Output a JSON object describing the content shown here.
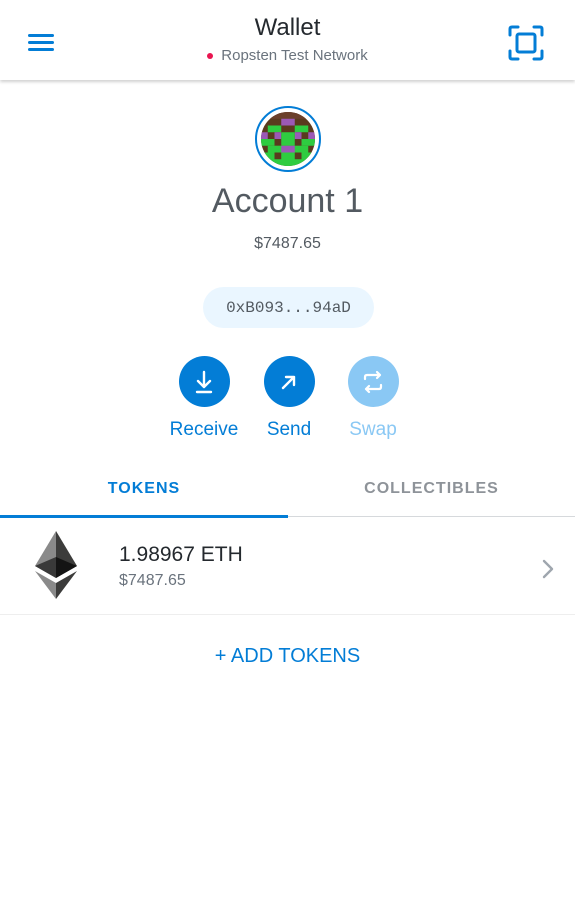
{
  "header": {
    "title": "Wallet",
    "network_name": "Ropsten Test Network",
    "network_color": "#e91550",
    "menu_icon": "hamburger-menu-icon",
    "scan_icon": "qr-scan-icon"
  },
  "account": {
    "name": "Account 1",
    "balance": "$7487.65",
    "address_short": "0xB093...94aD",
    "avatar_icon": "identicon-avatar"
  },
  "actions": {
    "receive": {
      "label": "Receive",
      "icon": "receive-arrow-down-icon"
    },
    "send": {
      "label": "Send",
      "icon": "send-arrow-up-right-icon"
    },
    "swap": {
      "label": "Swap",
      "icon": "swap-arrows-icon",
      "disabled": true
    }
  },
  "tabs": {
    "tokens": "TOKENS",
    "collectibles": "COLLECTIBLES",
    "active": "tokens"
  },
  "tokens": [
    {
      "amount": "1.98967 ETH",
      "fiat": "$7487.65",
      "icon": "ethereum-logo-icon"
    }
  ],
  "add_tokens_label": "+ ADD TOKENS",
  "colors": {
    "accent": "#037dd6",
    "disabled": "#8ac8f4",
    "pill_bg": "#eaf6ff"
  }
}
